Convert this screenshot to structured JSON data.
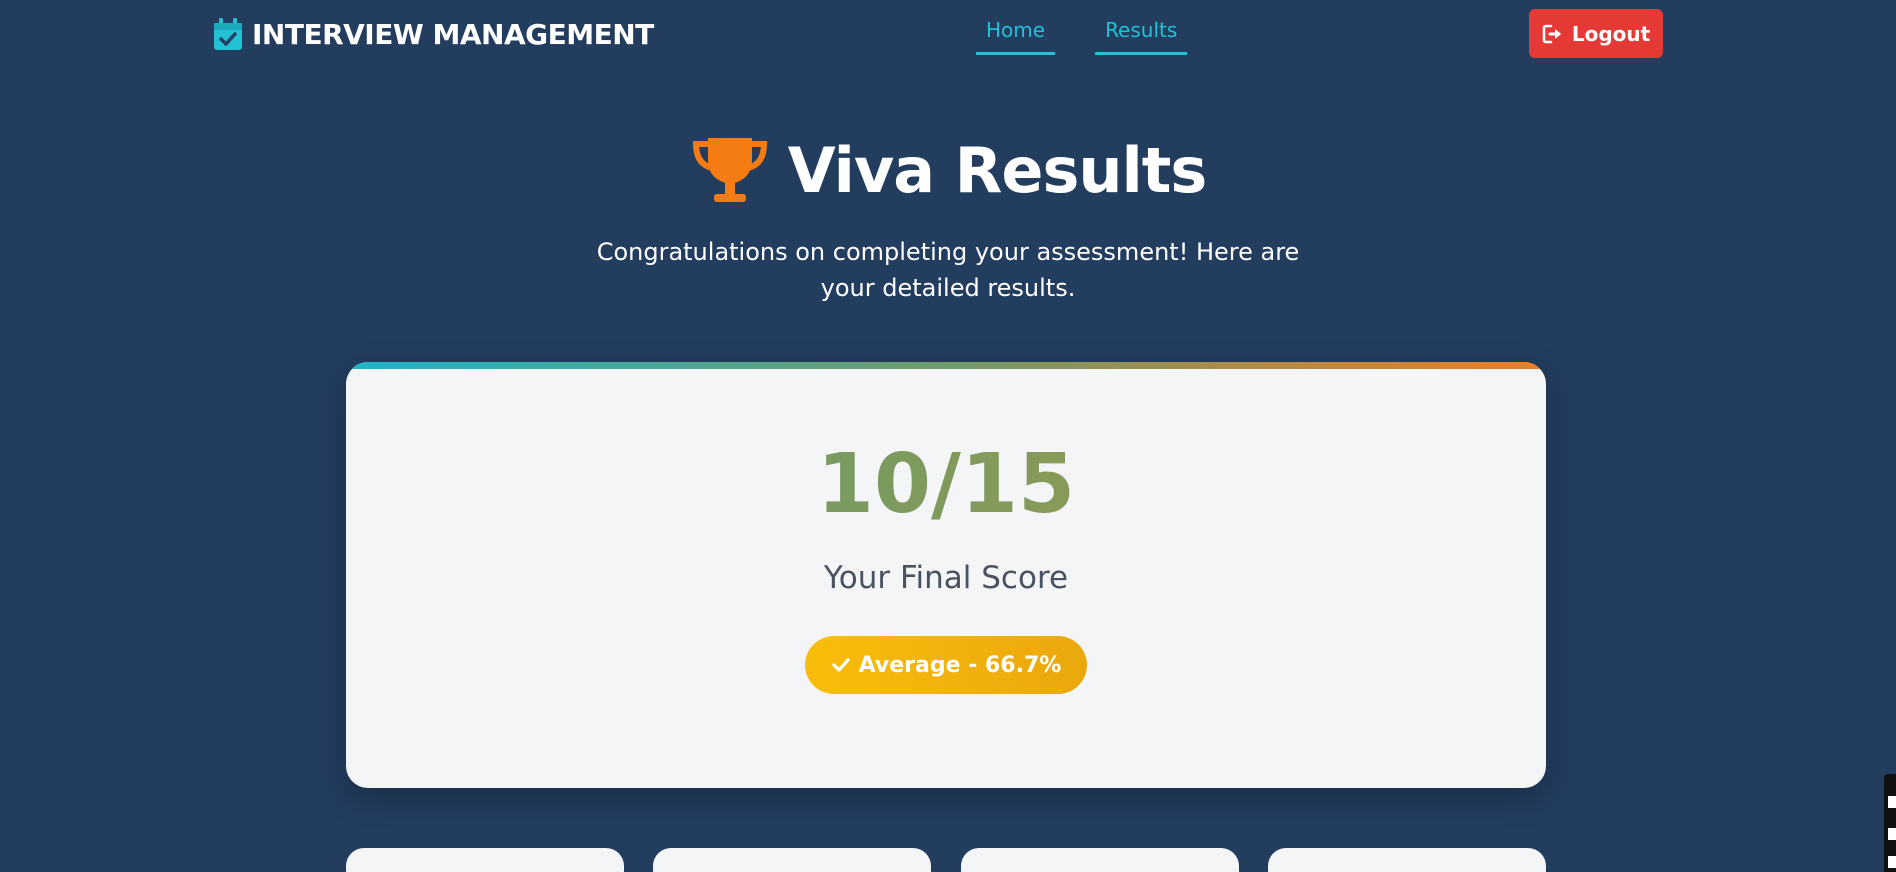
{
  "navbar": {
    "brand": "INTERVIEW MANAGEMENT",
    "brand_icon": "calendar-check-icon",
    "links": [
      {
        "label": "Home"
      },
      {
        "label": "Results"
      }
    ],
    "logout_label": "Logout",
    "logout_icon": "sign-out-icon"
  },
  "hero": {
    "icon": "trophy-icon",
    "title": "Viva Results",
    "subtitle": "Congratulations on completing your assessment! Here are your detailed results."
  },
  "score": {
    "value": "10/15",
    "label": "Your Final Score",
    "badge": "Average - 66.7%",
    "badge_icon": "check-icon"
  },
  "colors": {
    "background": "#233d5f",
    "accent": "#22c1d6",
    "logout": "#e53935",
    "trophy": "#f57c12",
    "badge": "#f9bd0b"
  }
}
